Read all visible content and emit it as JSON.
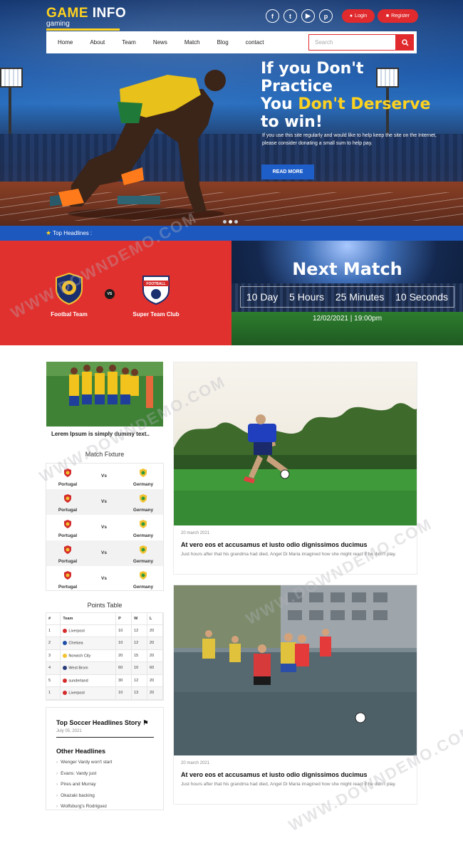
{
  "brand": {
    "title_a": "GAME",
    "title_b": "INFO",
    "tagline": "gaming",
    "colors": {
      "accent": "#ffd21f",
      "red": "#e02a2d",
      "blue": "#1d58bf"
    }
  },
  "header": {
    "social_icons": [
      "facebook-icon",
      "twitter-icon",
      "youtube-icon",
      "pinterest-icon"
    ],
    "social_glyphs": [
      "f",
      "t",
      "▶",
      "p"
    ],
    "login_label": "Login",
    "register_label": "Register"
  },
  "nav": {
    "items": [
      "Home",
      "About",
      "Team",
      "News",
      "Match",
      "Blog",
      "contact"
    ],
    "search_placeholder": "Search"
  },
  "hero": {
    "line1": "If you Don't",
    "line2": "Practice",
    "line3_white": "You ",
    "line3_yellow": "Don't Derserve",
    "line4": "to win!",
    "text1": "If you use this site regularly and would like to help keep the site on the Internet,",
    "text2": "please consider donating a small sum to help pay.",
    "cta": "READ MORE",
    "slide_count": 3,
    "active_slide": 2
  },
  "ticker": {
    "label": "Top Headlines :"
  },
  "match": {
    "team_home": "Footbal Team",
    "vs": "VS",
    "team_away": "Super Team Club",
    "away_badge_text": "FOOTBALL",
    "next_title": "Next Match",
    "countdown": [
      "10 Day",
      "5 Hours",
      "25 Minutes",
      "10 Seconds"
    ],
    "date": "12/02/2021 | 19:00pm"
  },
  "sidebar": {
    "news_caption": "Lerem Ipsum is simply dummy text..",
    "fixture_title": "Match Fixture",
    "fixtures": [
      {
        "home": "Portugal",
        "vs": "Vs",
        "away": "Germany"
      },
      {
        "home": "Portugal",
        "vs": "Vs",
        "away": "Germany"
      },
      {
        "home": "Portugal",
        "vs": "Vs",
        "away": "Germany"
      },
      {
        "home": "Portugal",
        "vs": "Vs",
        "away": "Germany"
      },
      {
        "home": "Portugal",
        "vs": "Vs",
        "away": "Germany"
      }
    ],
    "points_title": "Points Table",
    "points_headers": [
      "#",
      "Team",
      "P",
      "W",
      "L"
    ],
    "points_rows": [
      [
        "1",
        "Liverpool",
        "10",
        "12",
        "20"
      ],
      [
        "2",
        "Chelsea",
        "10",
        "12",
        "20"
      ],
      [
        "3",
        "Norwich City",
        "20",
        "15",
        "20"
      ],
      [
        "4",
        "West Brom",
        "60",
        "10",
        "60"
      ],
      [
        "5",
        "sunderland",
        "30",
        "12",
        "20"
      ],
      [
        "1",
        "Liverpool",
        "10",
        "13",
        "20"
      ]
    ],
    "headlines_title": "Top Soccer Headlines Story",
    "headlines_date": "July 05, 2021",
    "other_title": "Other Headlines",
    "other_items": [
      "Wenger Vardy won't start",
      "Evans: Vardy just",
      "Pires and Murray",
      "Okazaki backing",
      "Wolfsburg's Rodriguez"
    ]
  },
  "posts": [
    {
      "date": "20 march 2021",
      "title": "At vero eos et accusamus et iusto odio dignissimos ducimus",
      "desc": "Just hours after that his grandma had died, Angel Di Maria imagined how she might react if he didn't play."
    },
    {
      "date": "20 march 2021",
      "title": "At vero eos et accusamus et iusto odio dignissimos ducimus",
      "desc": "Just hours after that his grandma had died, Angel Di Maria imagined how she might react if he didn't play."
    }
  ],
  "watermark": "WWW.DOWNDEMO.COM"
}
